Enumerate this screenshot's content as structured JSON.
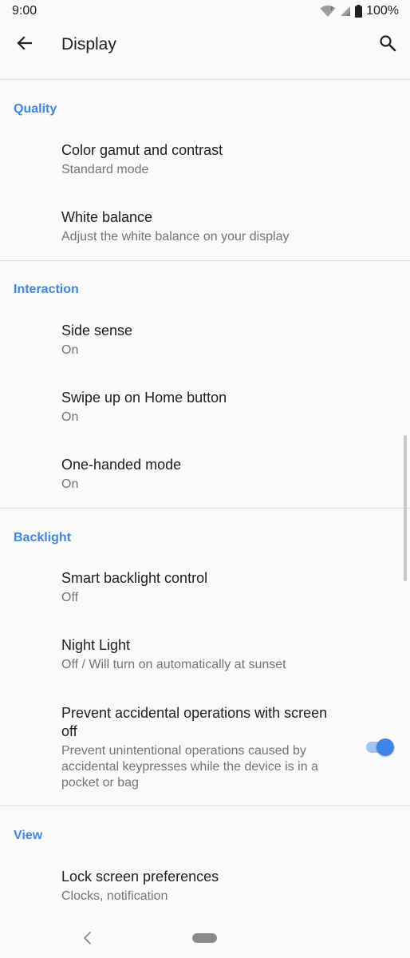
{
  "status_bar": {
    "time": "9:00",
    "battery": "100%",
    "icons": [
      "wifi-icon",
      "signal-icon",
      "battery-icon"
    ]
  },
  "app_bar": {
    "title": "Display",
    "back_icon": "arrow-back-icon",
    "search_icon": "search-icon"
  },
  "sections": [
    {
      "header": "Quality",
      "items": [
        {
          "title": "Color gamut and contrast",
          "summary": "Standard mode"
        },
        {
          "title": "White balance",
          "summary": "Adjust the white balance on your display"
        }
      ]
    },
    {
      "header": "Interaction",
      "items": [
        {
          "title": "Side sense",
          "summary": "On"
        },
        {
          "title": "Swipe up on Home button",
          "summary": "On"
        },
        {
          "title": "One-handed mode",
          "summary": "On"
        }
      ]
    },
    {
      "header": "Backlight",
      "items": [
        {
          "title": "Smart backlight control",
          "summary": "Off"
        },
        {
          "title": "Night Light",
          "summary": "Off / Will turn on automatically at sunset"
        },
        {
          "title": "Prevent accidental operations with screen off",
          "summary": "Prevent unintentional operations caused by accidental keypresses while the device is in a pocket or bag",
          "toggle": true
        }
      ]
    },
    {
      "header": "View",
      "items": [
        {
          "title": "Lock screen preferences",
          "summary": "Clocks, notification"
        }
      ]
    }
  ],
  "colors": {
    "accent": "#3d86e8",
    "background": "#fafafa",
    "primary_text": "#212121",
    "secondary_text": "#757575"
  },
  "nav_bar": {
    "back_icon": "nav-back-icon",
    "home_icon": "nav-home-pill-icon"
  }
}
